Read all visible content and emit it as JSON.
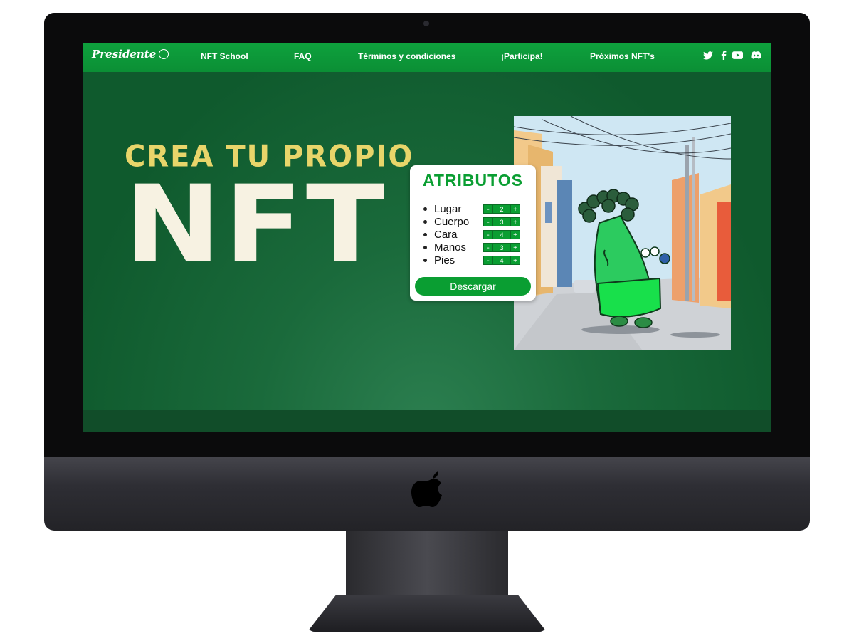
{
  "nav": {
    "brand": "Presidente",
    "links": [
      "NFT School",
      "FAQ",
      "Términos y condiciones",
      "¡Participa!",
      "Próximos NFT's"
    ],
    "social_icons": [
      "twitter-icon",
      "facebook-icon",
      "youtube-icon",
      "discord-icon"
    ]
  },
  "hero": {
    "subtitle": "CREA TU PROPIO",
    "title": "NFT"
  },
  "attributes": {
    "title": "ATRIBUTOS",
    "items": [
      {
        "label": "Lugar",
        "value": "2"
      },
      {
        "label": "Cuerpo",
        "value": "3"
      },
      {
        "label": "Cara",
        "value": "4"
      },
      {
        "label": "Manos",
        "value": "3"
      },
      {
        "label": "Pies",
        "value": "4"
      }
    ],
    "minus": "-",
    "plus": "+",
    "download": "Descargar"
  },
  "colors": {
    "accent": "#0a9e32",
    "background": "#1a6a3b",
    "hero_subtitle": "#e8d56a"
  }
}
